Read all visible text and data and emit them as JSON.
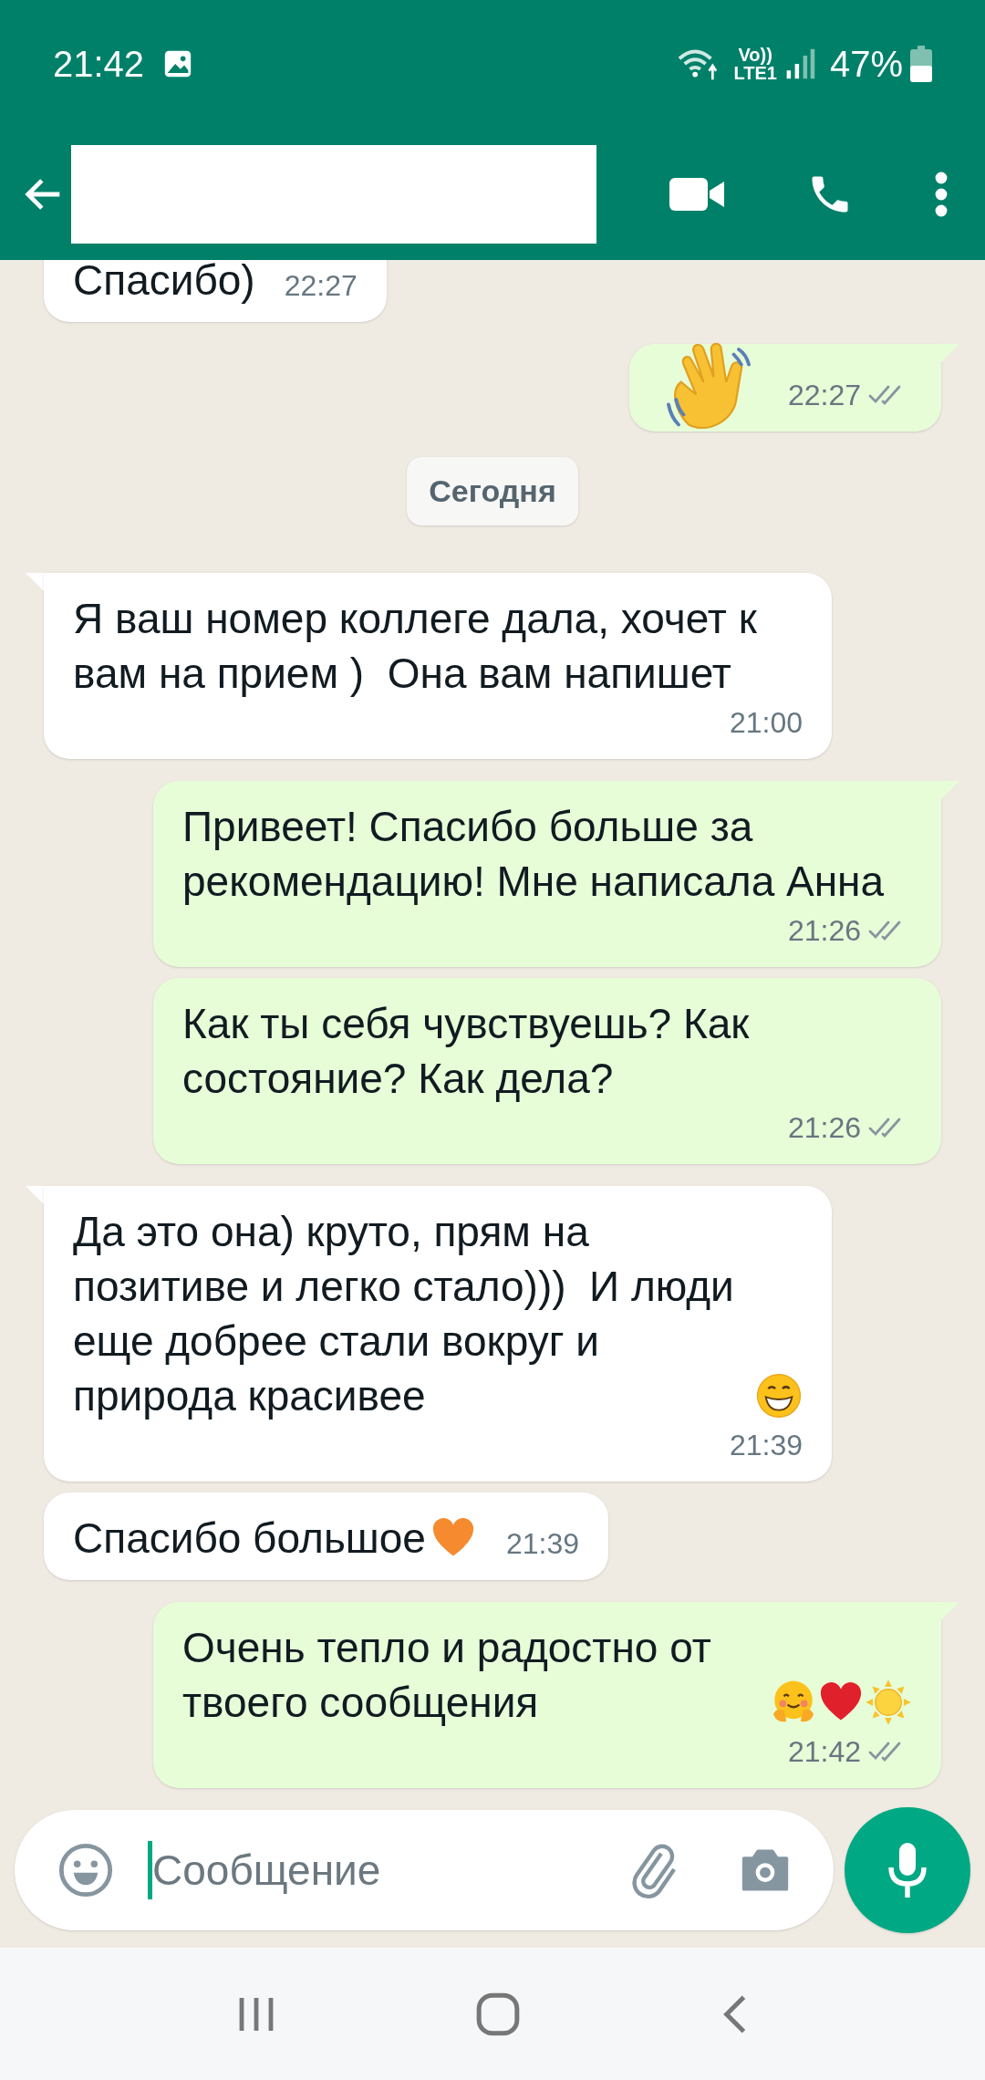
{
  "status_bar": {
    "time": "21:42",
    "network_top": "Vo))",
    "network_bottom": "LTE1",
    "battery": "47%"
  },
  "header": {
    "redacted": true
  },
  "messages": [
    {
      "kind": "incoming",
      "text": "Спасибо)",
      "time": "22:27",
      "tail": false
    },
    {
      "kind": "outgoing",
      "time": "22:27",
      "tail": true,
      "read": false,
      "emojis": [
        {
          "kind": "wave"
        }
      ]
    },
    {
      "kind": "date",
      "text": "Сегодня"
    },
    {
      "kind": "incoming",
      "text": "Я ваш номер коллеге дала, хочет к вам на прием )  Она вам напишет",
      "time": "21:00",
      "tail": true
    },
    {
      "kind": "outgoing",
      "text": "Привеет! Спасибо больше за рекомендацию! Мне написала Анна",
      "time": "21:26",
      "tail": true,
      "read": false
    },
    {
      "kind": "outgoing",
      "text": "Как ты себя чувствуешь? Как состояние? Как дела?",
      "time": "21:26",
      "tail": false,
      "read": false
    },
    {
      "kind": "incoming",
      "text": "Да это она) круто, прям на позитиве и легко стало)))  И люди еще добрее стали вокруг и природа красивее",
      "time": "21:39",
      "tail": true,
      "emojis": [
        {
          "kind": "grin"
        }
      ]
    },
    {
      "kind": "incoming",
      "text": "Спасибо большое",
      "time": "21:39",
      "tail": false,
      "emojis": [
        {
          "kind": "heart",
          "color": "#f68a2e"
        }
      ]
    },
    {
      "kind": "outgoing",
      "text": "Очень тепло и радостно от твоего сообщения",
      "time": "21:42",
      "tail": true,
      "read": false,
      "emojis": [
        {
          "kind": "hug"
        },
        {
          "kind": "heart",
          "color": "#e0202b"
        },
        {
          "kind": "sun"
        }
      ]
    }
  ],
  "composer": {
    "placeholder": "Сообщение"
  }
}
